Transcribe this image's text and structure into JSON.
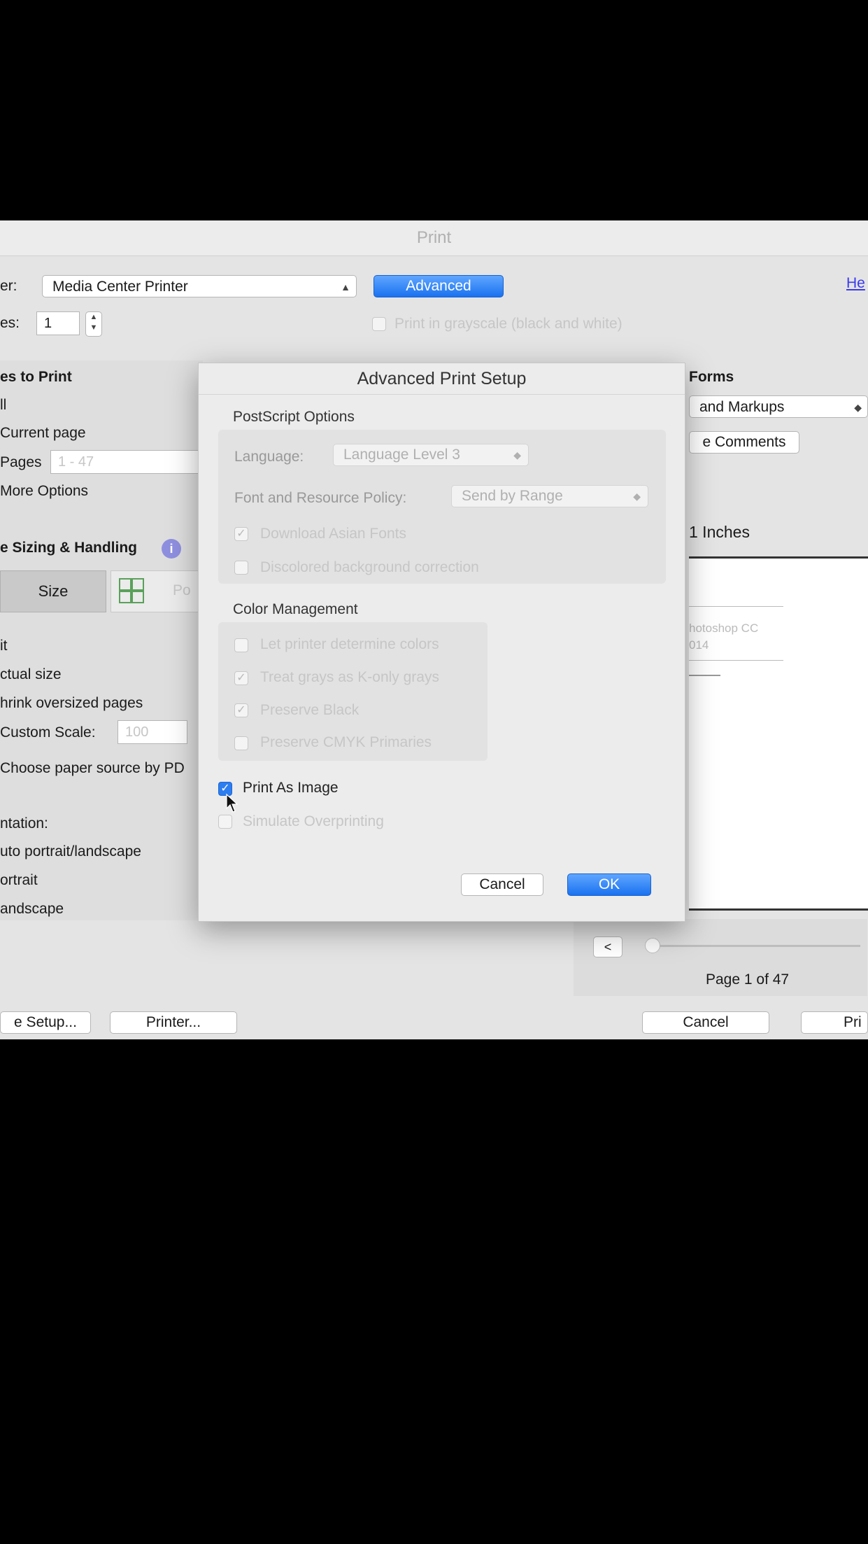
{
  "window": {
    "title": "Print"
  },
  "printer": {
    "label": "er:",
    "value": "Media Center Printer",
    "advanced_label": "Advanced",
    "help_link": "He",
    "copies_label": "es:",
    "copies_value": "1",
    "grayscale_label": "Print in grayscale (black and white)"
  },
  "pages_to_print": {
    "title": "es to Print",
    "all": "ll",
    "current_page": "Current page",
    "pages": "Pages",
    "pages_value": "1 - 47",
    "more_options": "More Options"
  },
  "sizing": {
    "title": "e Sizing & Handling",
    "info_icon": "info-icon",
    "size_tab": "Size",
    "poster_tab": "Po",
    "fit": "it",
    "actual_size": "ctual size",
    "shrink": "hrink oversized pages",
    "custom_scale": "Custom Scale:",
    "custom_scale_value": "100",
    "paper_source": "Choose paper source by PD"
  },
  "orientation": {
    "title": "ntation:",
    "auto": "uto portrait/landscape",
    "portrait": "ortrait",
    "landscape": "andscape"
  },
  "forms": {
    "title": "Forms",
    "select_value": "and Markups",
    "comments_button": "e Comments",
    "size_text": "1 Inches"
  },
  "preview": {
    "line1": "hotoshop CC",
    "line2": "014",
    "page_text": "Page 1 of 47",
    "prev_label": "<"
  },
  "bottom": {
    "page_setup": "e Setup...",
    "printer_button": "Printer...",
    "cancel": "Cancel",
    "print": "Pri"
  },
  "dialog": {
    "title": "Advanced Print Setup",
    "postscript_title": "PostScript Options",
    "language_label": "Language:",
    "language_value": "Language Level 3",
    "font_policy_label": "Font and Resource Policy:",
    "font_policy_value": "Send by Range",
    "download_asian": "Download Asian Fonts",
    "discolored_bg": "Discolored background correction",
    "color_title": "Color Management",
    "let_printer": "Let printer determine colors",
    "treat_grays": "Treat grays as K-only grays",
    "preserve_black": "Preserve Black",
    "preserve_cmyk": "Preserve CMYK Primaries",
    "print_as_image": "Print As Image",
    "simulate_overprinting": "Simulate Overprinting",
    "cancel": "Cancel",
    "ok": "OK"
  }
}
